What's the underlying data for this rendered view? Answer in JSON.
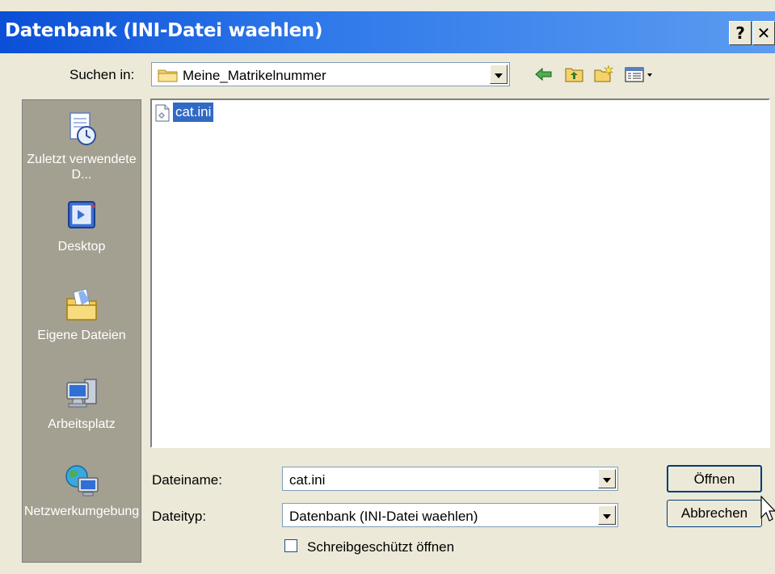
{
  "window": {
    "title": "Datenbank (INI-Datei waehlen)"
  },
  "titlebar_buttons": {
    "help": "?",
    "close": "✕"
  },
  "lookin": {
    "label": "Suchen in:",
    "value": "Meine_Matrikelnummer"
  },
  "places": [
    {
      "label": "Zuletzt verwendete D...",
      "icon": "recent-documents-icon"
    },
    {
      "label": "Desktop",
      "icon": "desktop-icon"
    },
    {
      "label": "Eigene Dateien",
      "icon": "my-documents-icon"
    },
    {
      "label": "Arbeitsplatz",
      "icon": "my-computer-icon"
    },
    {
      "label": "Netzwerkumgebung",
      "icon": "network-places-icon"
    }
  ],
  "files": [
    {
      "name": "cat.ini",
      "selected": true
    }
  ],
  "filename": {
    "label": "Dateiname:",
    "value": "cat.ini"
  },
  "filetype": {
    "label": "Dateityp:",
    "value": "Datenbank (INI-Datei waehlen)"
  },
  "readonly": {
    "label": "Schreibgeschützt öffnen",
    "checked": false
  },
  "buttons": {
    "open": "Öffnen",
    "cancel": "Abbrechen"
  },
  "colors": {
    "titlebar": "#0a4fd6",
    "dialog": "#ece9d8",
    "places_bar": "#a4a091",
    "selection": "#316ac5"
  }
}
